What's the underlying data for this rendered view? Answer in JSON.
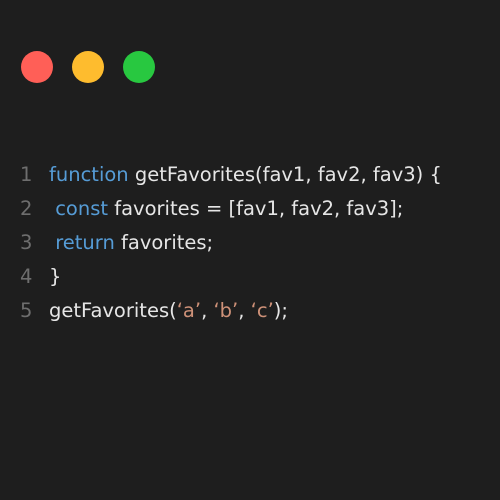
{
  "window_controls": [
    {
      "name": "close",
      "color": "#ff5f57"
    },
    {
      "name": "minimize",
      "color": "#febc2e"
    },
    {
      "name": "maximize",
      "color": "#28c840"
    }
  ],
  "colors": {
    "background": "#1e1e1e",
    "keyword": "#569cd6",
    "string": "#ce9178",
    "text": "#e6e6e6",
    "line_number": "#6e6e6e"
  },
  "code": {
    "lines": [
      {
        "number": "1",
        "tokens": [
          {
            "t": "function",
            "k": "kw"
          },
          {
            "t": " getFavorites(fav1, fav2, fav3) {",
            "k": ""
          }
        ]
      },
      {
        "number": "2",
        "tokens": [
          {
            "t": " ",
            "k": ""
          },
          {
            "t": "const",
            "k": "kw"
          },
          {
            "t": " favorites = [fav1, fav2, fav3];",
            "k": ""
          }
        ]
      },
      {
        "number": "3",
        "tokens": [
          {
            "t": " ",
            "k": ""
          },
          {
            "t": "return",
            "k": "kw"
          },
          {
            "t": " favorites;",
            "k": ""
          }
        ]
      },
      {
        "number": "4",
        "tokens": [
          {
            "t": "}",
            "k": ""
          }
        ]
      },
      {
        "number": "5",
        "tokens": [
          {
            "t": "getFavorites(",
            "k": ""
          },
          {
            "t": "‘a’",
            "k": "st"
          },
          {
            "t": ", ",
            "k": ""
          },
          {
            "t": "‘b’",
            "k": "st"
          },
          {
            "t": ", ",
            "k": ""
          },
          {
            "t": "‘c’",
            "k": "st"
          },
          {
            "t": ");",
            "k": ""
          }
        ]
      }
    ]
  }
}
